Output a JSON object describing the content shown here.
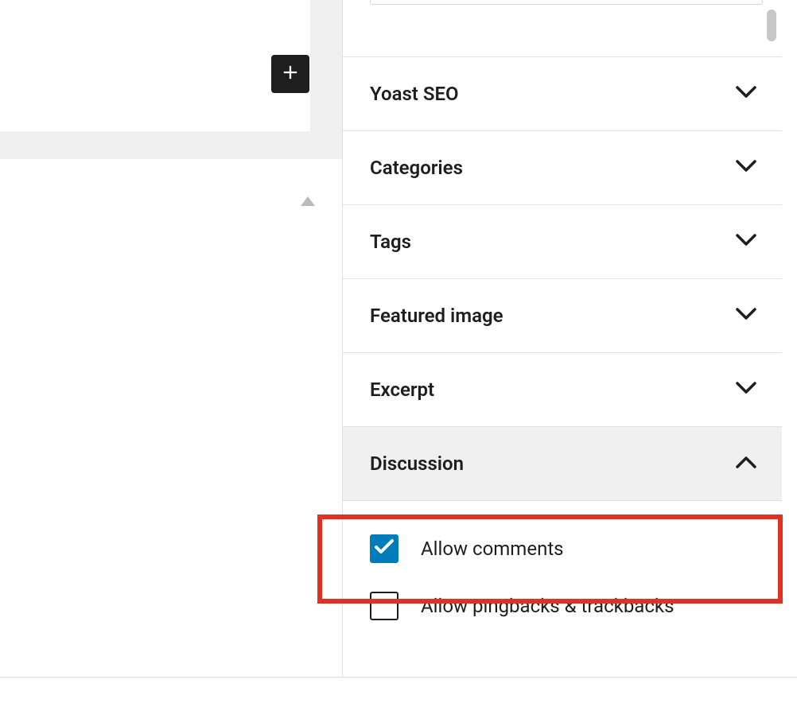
{
  "sidebar": {
    "panels": [
      {
        "id": "yoast-seo",
        "title": "Yoast SEO",
        "expanded": false
      },
      {
        "id": "categories",
        "title": "Categories",
        "expanded": false
      },
      {
        "id": "tags",
        "title": "Tags",
        "expanded": false
      },
      {
        "id": "featured-image",
        "title": "Featured image",
        "expanded": false
      },
      {
        "id": "excerpt",
        "title": "Excerpt",
        "expanded": false
      },
      {
        "id": "discussion",
        "title": "Discussion",
        "expanded": true
      }
    ],
    "discussion": {
      "allow_comments": {
        "label": "Allow comments",
        "checked": true
      },
      "allow_pingbacks": {
        "label": "Allow pingbacks & trackbacks",
        "checked": false
      }
    }
  }
}
